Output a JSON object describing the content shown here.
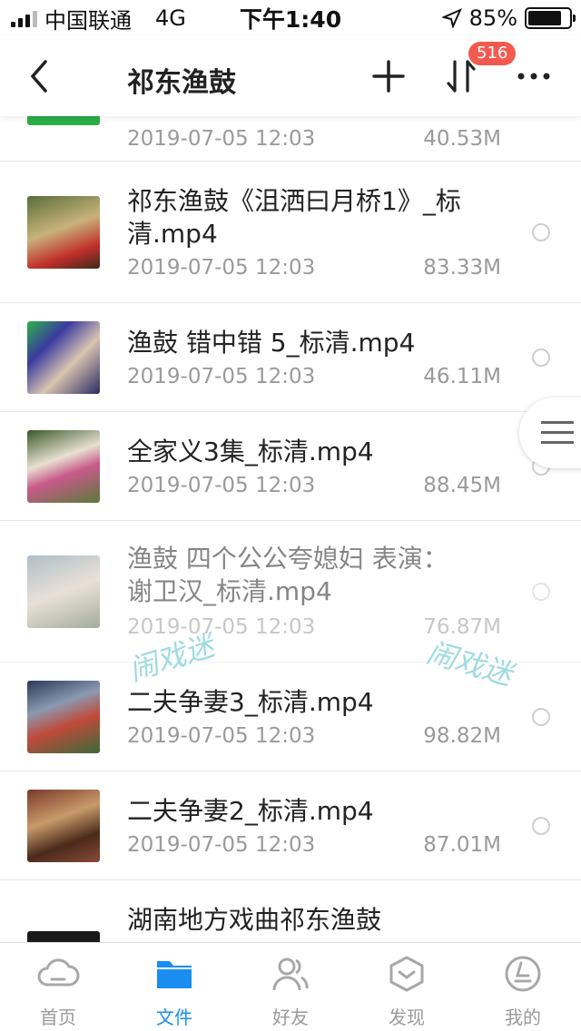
{
  "status": {
    "carrier": "中国联通",
    "network": "4G",
    "time": "下午1:40",
    "battery": "85%"
  },
  "nav": {
    "title": "祁东渔鼓",
    "badge": "516",
    "icons": [
      "back-icon",
      "plus-icon",
      "sort-icon",
      "more-icon"
    ]
  },
  "files": [
    {
      "name": "",
      "date": "2019-07-05 12:03",
      "size": "40.53M"
    },
    {
      "name": "祁东渔鼓《沮洒曰月桥1》_标清.mp4",
      "date": "2019-07-05 12:03",
      "size": "83.33M"
    },
    {
      "name": "渔鼓 错中错 5_标清.mp4",
      "date": "2019-07-05 12:03",
      "size": "46.11M"
    },
    {
      "name": "全家义3集_标清.mp4",
      "date": "2019-07-05 12:03",
      "size": "88.45M"
    },
    {
      "name": "渔鼓  四个公公夸媳妇  表演：谢卫汉_标清.mp4",
      "date": "2019-07-05 12:03",
      "size": "76.87M"
    },
    {
      "name": "二夫争妻3_标清.mp4",
      "date": "2019-07-05 12:03",
      "size": "98.82M"
    },
    {
      "name": "二夫争妻2_标清.mp4",
      "date": "2019-07-05 12:03",
      "size": "87.01M"
    },
    {
      "name": "湖南地方戏曲祁东渔鼓",
      "date": "",
      "size": ""
    }
  ],
  "watermark": "闹戏迷",
  "tabs": [
    {
      "label": "首页",
      "icon": "cloud-icon",
      "active": false
    },
    {
      "label": "文件",
      "icon": "folder-icon",
      "active": true
    },
    {
      "label": "好友",
      "icon": "friends-icon",
      "active": false
    },
    {
      "label": "发现",
      "icon": "discover-icon",
      "active": false
    },
    {
      "label": "我的",
      "icon": "profile-icon",
      "active": false
    }
  ],
  "colors": {
    "accent": "#1a8ef0",
    "badge": "#f25a50",
    "watermark": "#7ed0d8"
  }
}
